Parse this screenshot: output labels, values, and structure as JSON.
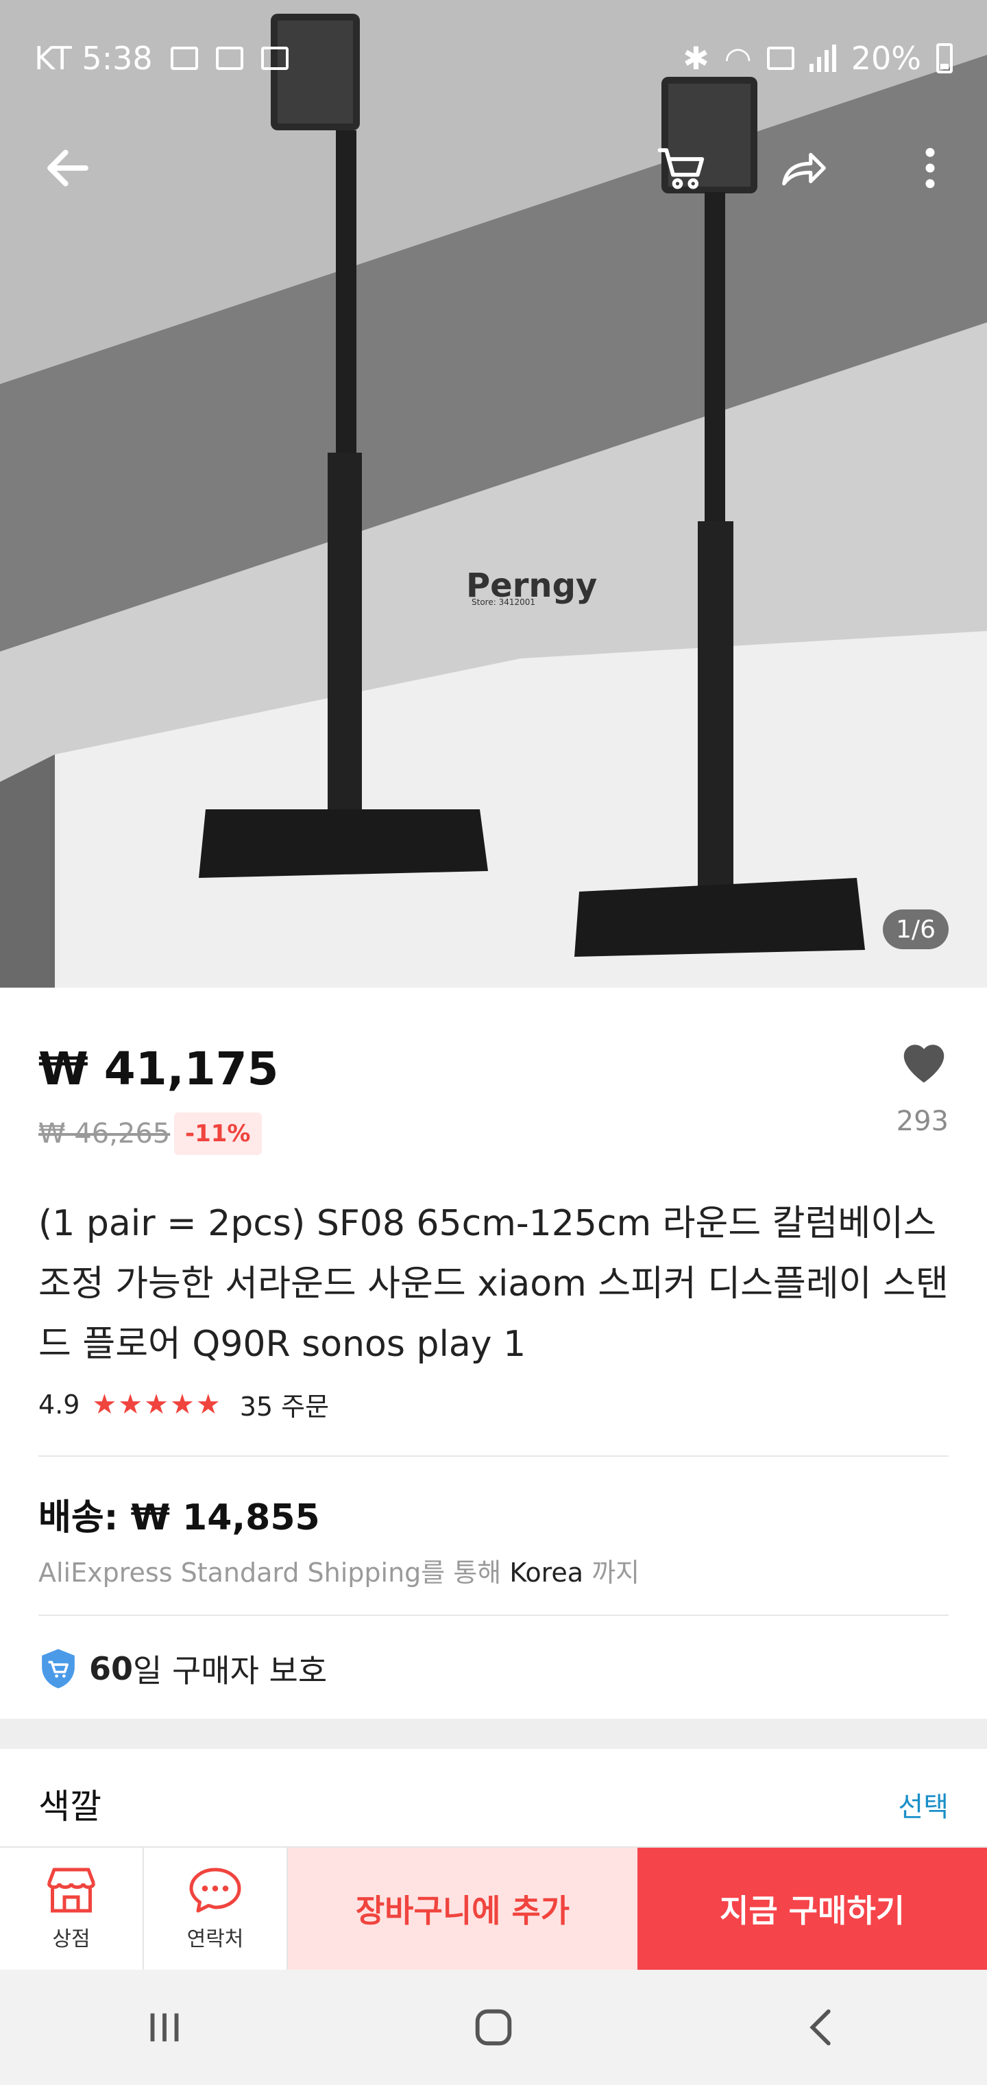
{
  "status_bar": {
    "carrier_time": "KT 5:38",
    "battery": "20%"
  },
  "hero": {
    "brand_watermark": "Perngy",
    "store_watermark": "Store: 3412001",
    "image_counter": "1/6"
  },
  "product": {
    "price": "₩ 41,175",
    "original_price": "₩ 46,265",
    "discount": "-11%",
    "wishlist_count": "293",
    "title": "(1 pair = 2pcs) SF08 65cm-125cm 라운드 칼럼베이스 조정 가능한 서라운드 사운드 xiaom 스피커 디스플레이 스탠드 플로어 Q90R sonos play 1",
    "rating": "4.9",
    "stars": "★★★★★",
    "orders": "35 주문"
  },
  "shipping": {
    "label": "배송: ₩ 14,855",
    "method_prefix": "AliExpress Standard Shipping를 통해",
    "destination": "Korea",
    "method_suffix": "까지"
  },
  "protection": {
    "days": "60",
    "text": "일 구매자 보호"
  },
  "color": {
    "label": "색깔",
    "select": "선택"
  },
  "actions": {
    "store": "상점",
    "contact": "연락처",
    "add_to_cart": "장바구니에 추가",
    "buy_now": "지금 구매하기"
  },
  "colors": {
    "accent_red": "#f5444a",
    "light_red": "#ffe3e3",
    "link_blue": "#1a8fc8",
    "shield_blue": "#4a9ae8"
  },
  "icons": [
    "back-icon",
    "cart-icon",
    "share-icon",
    "more-icon",
    "heart-icon",
    "shield-cart-icon",
    "store-icon",
    "chat-icon",
    "recent-apps-icon",
    "home-icon",
    "nav-back-icon"
  ]
}
